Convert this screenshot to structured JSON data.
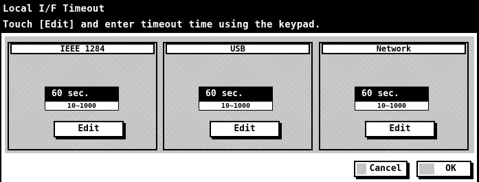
{
  "header": {
    "title": "Local I/F Timeout",
    "instruction": "Touch [Edit] and enter timeout time using the keypad."
  },
  "panels": [
    {
      "label": "IEEE 1284",
      "value": "60 sec.",
      "range": "10~1000",
      "edit_label": "Edit"
    },
    {
      "label": "USB",
      "value": "60 sec.",
      "range": "10~1000",
      "edit_label": "Edit"
    },
    {
      "label": "Network",
      "value": "60 sec.",
      "range": "10~1000",
      "edit_label": "Edit"
    }
  ],
  "footer": {
    "cancel_label": "Cancel",
    "ok_label": "OK"
  }
}
